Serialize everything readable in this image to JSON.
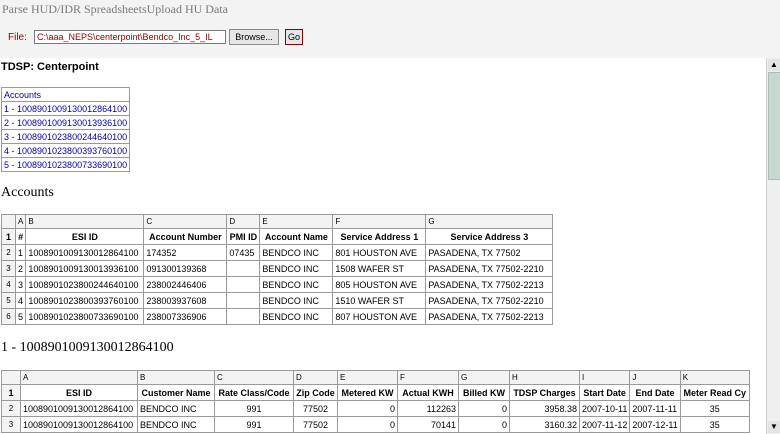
{
  "topnav": {
    "parse": "Parse HUD/IDR Spreadsheets",
    "upload": "Upload HU Data"
  },
  "upload": {
    "file_label": "File:",
    "file_value": "C:\\aaa_NEPS\\centerpoint\\Bendco_Inc_5_IL",
    "browse_label": "Browse...",
    "go_label": "Go"
  },
  "tdsp_label": "TDSP: Centerpoint",
  "account_list": {
    "header": "Accounts",
    "items": [
      "1 - 1008901009130012864100",
      "2 - 1008901009130013936100",
      "3 - 1008901023800244640100",
      "4 - 1008901023800393760100",
      "5 - 1008901023800733690100"
    ]
  },
  "accounts_section": {
    "title": "Accounts",
    "col_letters": [
      "A",
      "B",
      "C",
      "D",
      "E",
      "F",
      "G"
    ],
    "headers": [
      "#",
      "ESI ID",
      "Account Number",
      "PMI ID",
      "Account Name",
      "Service Address 1",
      "Service Address 3"
    ],
    "rows": [
      [
        "1",
        "1008901009130012864100",
        "174352",
        "07435",
        "BENDCO INC",
        "801 HOUSTON AVE",
        "PASADENA, TX 77502"
      ],
      [
        "2",
        "1008901009130013936100",
        "091300139368",
        "",
        "BENDCO INC",
        "1508 WAFER ST",
        "PASADENA, TX 77502-2210"
      ],
      [
        "3",
        "1008901023800244640100",
        "238002446406",
        "",
        "BENDCO INC",
        "805 HOUSTON AVE",
        "PASADENA, TX 77502-2213"
      ],
      [
        "4",
        "1008901023800393760100",
        "238003937608",
        "",
        "BENDCO INC",
        "1510 WAFER ST",
        "PASADENA, TX 77502-2210"
      ],
      [
        "5",
        "1008901023800733690100",
        "238007336906",
        "",
        "BENDCO INC",
        "807 HOUSTON AVE",
        "PASADENA, TX 77502-2213"
      ]
    ]
  },
  "detail_section": {
    "title": "1 - 1008901009130012864100",
    "col_letters": [
      "A",
      "B",
      "C",
      "D",
      "E",
      "F",
      "G",
      "H",
      "I",
      "J",
      "K"
    ],
    "headers": [
      "ESI ID",
      "Customer Name",
      "Rate Class/Code",
      "Zip Code",
      "Metered KW",
      "Actual KWH",
      "Billed KW",
      "TDSP Charges",
      "Start Date",
      "End Date",
      "Meter Read Cy"
    ],
    "rows": [
      [
        "1008901009130012864100",
        "BENDCO INC",
        "991",
        "77502",
        "0",
        "112263",
        "0",
        "3958.38",
        "2007-10-11",
        "2007-11-11",
        "35"
      ],
      [
        "1008901009130012864100",
        "BENDCO INC",
        "991",
        "77502",
        "0",
        "70141",
        "0",
        "3160.32",
        "2007-11-12",
        "2007-12-11",
        "35"
      ]
    ]
  }
}
